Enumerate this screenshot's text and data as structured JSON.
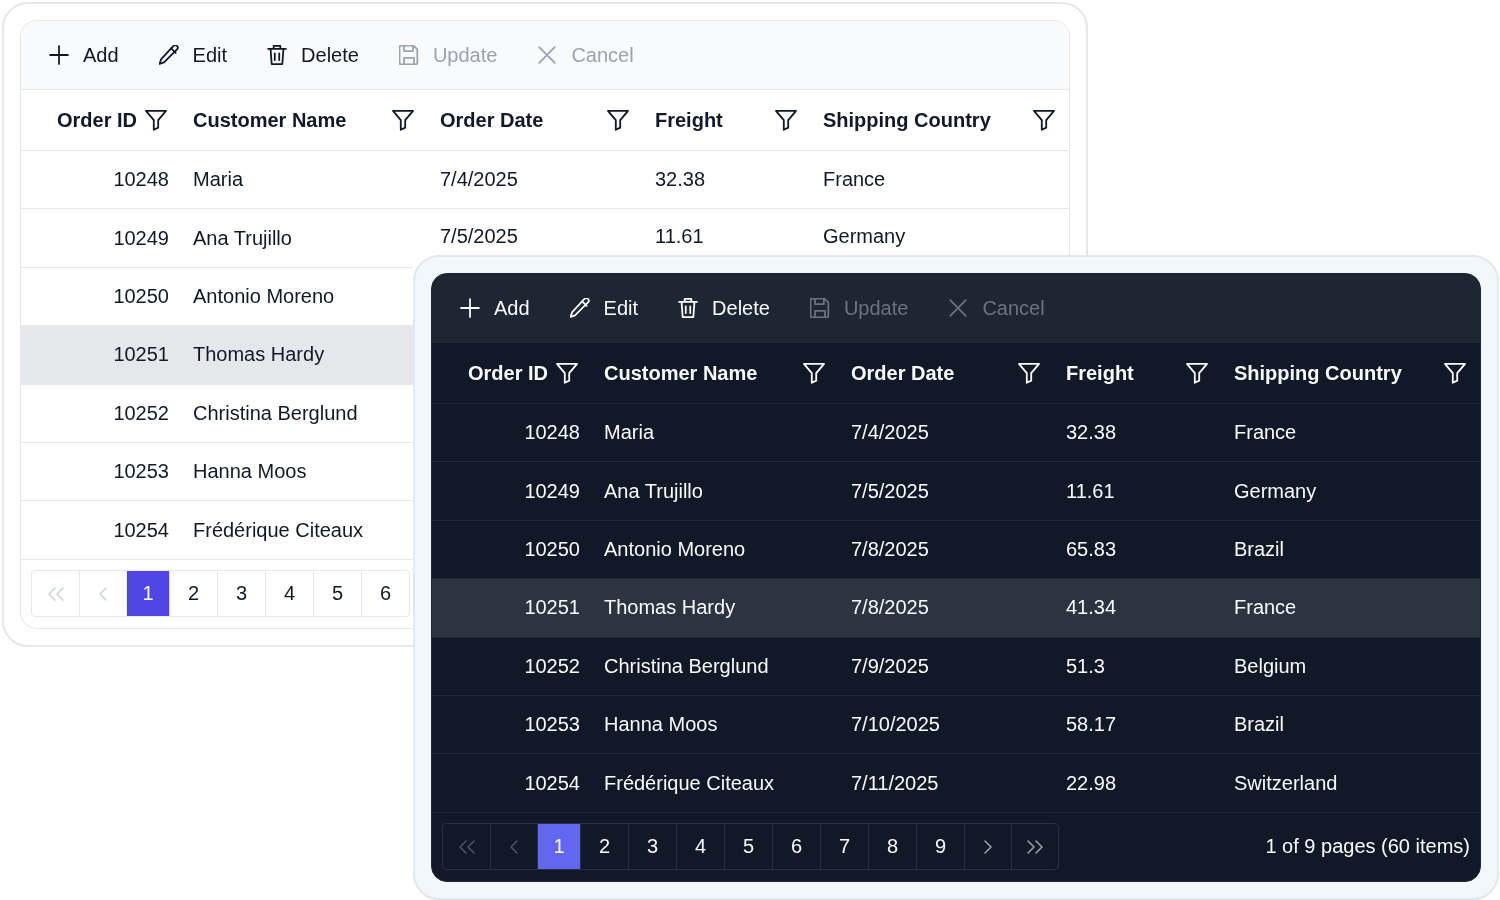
{
  "grids": [
    {
      "kind": "light",
      "toolbar": [
        {
          "kind": "add",
          "label": "Add",
          "disabled": false
        },
        {
          "kind": "edit",
          "label": "Edit",
          "disabled": false
        },
        {
          "kind": "delete",
          "label": "Delete",
          "disabled": false
        },
        {
          "kind": "update",
          "label": "Update",
          "disabled": true
        },
        {
          "kind": "cancel",
          "label": "Cancel",
          "disabled": true
        }
      ],
      "columns": [
        {
          "label": "Order ID",
          "kind": "number"
        },
        {
          "label": "Customer Name",
          "kind": "text"
        },
        {
          "label": "Order Date",
          "kind": "text"
        },
        {
          "label": "Freight",
          "kind": "text"
        },
        {
          "label": "Shipping Country",
          "kind": "text"
        }
      ],
      "rows": [
        {
          "selected": false,
          "cells": [
            "10248",
            "Maria",
            "7/4/2025",
            "32.38",
            "France"
          ]
        },
        {
          "selected": false,
          "cells": [
            "10249",
            "Ana Trujillo",
            "7/5/2025",
            "11.61",
            "Germany"
          ]
        },
        {
          "selected": false,
          "cells": [
            "10250",
            "Antonio Moreno"
          ]
        },
        {
          "selected": true,
          "cells": [
            "10251",
            "Thomas Hardy"
          ]
        },
        {
          "selected": false,
          "cells": [
            "10252",
            "Christina Berglund"
          ]
        },
        {
          "selected": false,
          "cells": [
            "10253",
            "Hanna Moos"
          ]
        },
        {
          "selected": false,
          "cells": [
            "10254",
            "Frédérique Citeaux"
          ]
        }
      ],
      "pager": {
        "nav_start": [
          {
            "kind": "first",
            "disabled": true
          },
          {
            "kind": "previous",
            "disabled": true
          }
        ],
        "pages": [
          {
            "label": "1",
            "selected": true
          },
          {
            "label": "2",
            "selected": false
          },
          {
            "label": "3",
            "selected": false
          },
          {
            "label": "4",
            "selected": false
          },
          {
            "label": "5",
            "selected": false
          },
          {
            "label": "6",
            "selected": false
          }
        ]
      }
    },
    {
      "kind": "dark",
      "toolbar": [
        {
          "kind": "add",
          "label": "Add",
          "disabled": false
        },
        {
          "kind": "edit",
          "label": "Edit",
          "disabled": false
        },
        {
          "kind": "delete",
          "label": "Delete",
          "disabled": false
        },
        {
          "kind": "update",
          "label": "Update",
          "disabled": true
        },
        {
          "kind": "cancel",
          "label": "Cancel",
          "disabled": true
        }
      ],
      "columns": [
        {
          "label": "Order ID",
          "kind": "number"
        },
        {
          "label": "Customer Name",
          "kind": "text"
        },
        {
          "label": "Order Date",
          "kind": "text"
        },
        {
          "label": "Freight",
          "kind": "text"
        },
        {
          "label": "Shipping Country",
          "kind": "text"
        }
      ],
      "rows": [
        {
          "selected": false,
          "cells": [
            "10248",
            "Maria",
            "7/4/2025",
            "32.38",
            "France"
          ]
        },
        {
          "selected": false,
          "cells": [
            "10249",
            "Ana Trujillo",
            "7/5/2025",
            "11.61",
            "Germany"
          ]
        },
        {
          "selected": false,
          "cells": [
            "10250",
            "Antonio Moreno",
            "7/8/2025",
            "65.83",
            "Brazil"
          ]
        },
        {
          "selected": true,
          "cells": [
            "10251",
            "Thomas Hardy",
            "7/8/2025",
            "41.34",
            "France"
          ]
        },
        {
          "selected": false,
          "cells": [
            "10252",
            "Christina Berglund",
            "7/9/2025",
            "51.3",
            "Belgium"
          ]
        },
        {
          "selected": false,
          "cells": [
            "10253",
            "Hanna Moos",
            "7/10/2025",
            "58.17",
            "Brazil"
          ]
        },
        {
          "selected": false,
          "cells": [
            "10254",
            "Frédérique Citeaux",
            "7/11/2025",
            "22.98",
            "Switzerland"
          ]
        }
      ],
      "pager": {
        "nav_start": [
          {
            "kind": "first",
            "disabled": true
          },
          {
            "kind": "previous",
            "disabled": true
          }
        ],
        "pages": [
          {
            "label": "1",
            "selected": true
          },
          {
            "label": "2",
            "selected": false
          },
          {
            "label": "3",
            "selected": false
          },
          {
            "label": "4",
            "selected": false
          },
          {
            "label": "5",
            "selected": false
          },
          {
            "label": "6",
            "selected": false
          },
          {
            "label": "7",
            "selected": false
          },
          {
            "label": "8",
            "selected": false
          },
          {
            "label": "9",
            "selected": false
          }
        ],
        "nav_end": [
          {
            "kind": "next",
            "disabled": false
          },
          {
            "kind": "last",
            "disabled": false
          }
        ],
        "info": "1 of 9 pages (60 items)"
      }
    }
  ]
}
